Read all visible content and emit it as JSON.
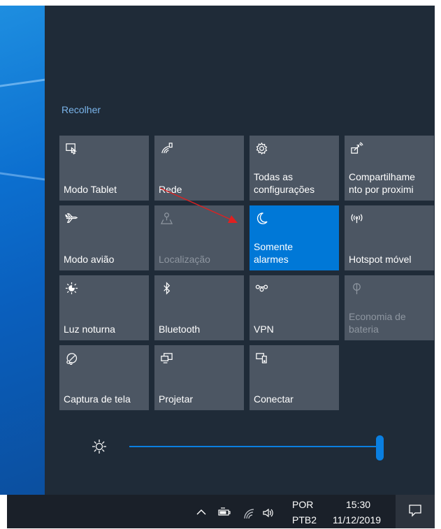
{
  "action_center": {
    "collapse_label": "Recolher",
    "tiles": [
      {
        "label": "Modo Tablet",
        "icon": "tablet-icon",
        "state": "normal"
      },
      {
        "label": "Rede",
        "icon": "network-icon",
        "state": "normal"
      },
      {
        "label": "Todas as configurações",
        "icon": "gear-icon",
        "state": "normal"
      },
      {
        "label": "Compartilhamento por proximi",
        "icon": "share-icon",
        "state": "normal"
      },
      {
        "label": "Modo avião",
        "icon": "airplane-icon",
        "state": "normal"
      },
      {
        "label": "Localização",
        "icon": "location-icon",
        "state": "disabled"
      },
      {
        "label": "Somente alarmes",
        "icon": "moon-icon",
        "state": "active"
      },
      {
        "label": "Hotspot móvel",
        "icon": "hotspot-icon",
        "state": "normal"
      },
      {
        "label": "Luz noturna",
        "icon": "night-light-icon",
        "state": "normal"
      },
      {
        "label": "Bluetooth",
        "icon": "bluetooth-icon",
        "state": "normal"
      },
      {
        "label": "VPN",
        "icon": "vpn-icon",
        "state": "normal"
      },
      {
        "label": "Economia de bateria",
        "icon": "battery-saver-icon",
        "state": "disabled"
      },
      {
        "label": "Captura de tela",
        "icon": "screen-snip-icon",
        "state": "normal"
      },
      {
        "label": "Projetar",
        "icon": "project-icon",
        "state": "normal"
      },
      {
        "label": "Conectar",
        "icon": "connect-icon",
        "state": "normal"
      }
    ],
    "brightness_level": 1.0
  },
  "tile_labels": {
    "t0": "Modo Tablet",
    "t1": "Rede",
    "t2a": "Todas as",
    "t2b": "configurações",
    "t3a": "Compartilhame",
    "t3b": "nto por proximi",
    "t4": "Modo avião",
    "t5": "Localização",
    "t6a": "Somente",
    "t6b": "alarmes",
    "t7": "Hotspot móvel",
    "t8": "Luz noturna",
    "t9": "Bluetooth",
    "t10": "VPN",
    "t11a": "Economia de",
    "t11b": "bateria",
    "t12": "Captura de tela",
    "t13": "Projetar",
    "t14": "Conectar"
  },
  "taskbar": {
    "language_top": "POR",
    "language_bottom": "PTB2",
    "time": "15:30",
    "date": "11/12/2019"
  },
  "colors": {
    "panel_bg": "#1f2b38",
    "tile_bg": "#4c5663",
    "accent": "#0078d7",
    "annotation_arrow": "#e02020"
  }
}
